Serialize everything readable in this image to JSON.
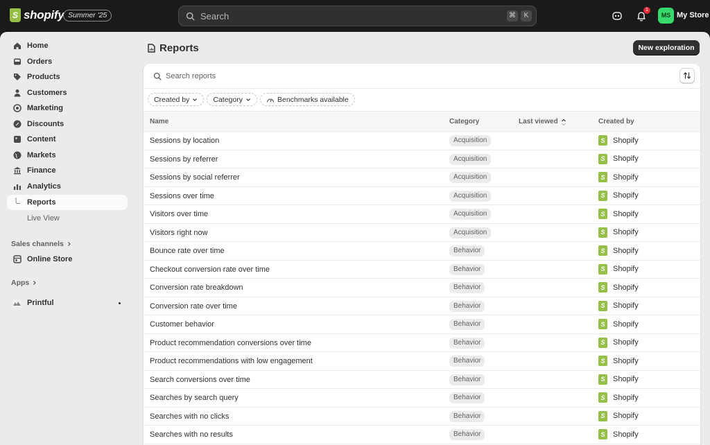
{
  "topbar": {
    "brand": "shopify",
    "edition": "Summer '25",
    "search_placeholder": "Search",
    "shortcut_cmd": "⌘",
    "shortcut_key": "K",
    "notification_count": "1",
    "avatar_initials": "MS",
    "store_name": "My Store"
  },
  "sidebar": {
    "items": [
      {
        "label": "Home",
        "icon": "home-icon"
      },
      {
        "label": "Orders",
        "icon": "inbox-icon"
      },
      {
        "label": "Products",
        "icon": "tag-icon"
      },
      {
        "label": "Customers",
        "icon": "person-icon"
      },
      {
        "label": "Marketing",
        "icon": "target-icon"
      },
      {
        "label": "Discounts",
        "icon": "discount-icon"
      },
      {
        "label": "Content",
        "icon": "content-icon"
      },
      {
        "label": "Markets",
        "icon": "globe-icon"
      },
      {
        "label": "Finance",
        "icon": "bank-icon"
      },
      {
        "label": "Analytics",
        "icon": "chart-icon"
      },
      {
        "label": "Reports",
        "icon": "branch-icon"
      },
      {
        "label": "Live View",
        "icon": ""
      }
    ],
    "sales_channels_label": "Sales channels",
    "online_store_label": "Online Store",
    "apps_label": "Apps",
    "printful_label": "Printful"
  },
  "page": {
    "title": "Reports",
    "new_button": "New exploration",
    "search_placeholder": "Search reports",
    "filters": [
      "Created by",
      "Category",
      "Benchmarks available"
    ],
    "columns": {
      "name": "Name",
      "category": "Category",
      "last_viewed": "Last viewed",
      "created_by": "Created by"
    }
  },
  "reports": [
    {
      "name": "Sessions by location",
      "category": "Acquisition",
      "created_by": "Shopify"
    },
    {
      "name": "Sessions by referrer",
      "category": "Acquisition",
      "created_by": "Shopify"
    },
    {
      "name": "Sessions by social referrer",
      "category": "Acquisition",
      "created_by": "Shopify"
    },
    {
      "name": "Sessions over time",
      "category": "Acquisition",
      "created_by": "Shopify"
    },
    {
      "name": "Visitors over time",
      "category": "Acquisition",
      "created_by": "Shopify"
    },
    {
      "name": "Visitors right now",
      "category": "Acquisition",
      "created_by": "Shopify"
    },
    {
      "name": "Bounce rate over time",
      "category": "Behavior",
      "created_by": "Shopify"
    },
    {
      "name": "Checkout conversion rate over time",
      "category": "Behavior",
      "created_by": "Shopify"
    },
    {
      "name": "Conversion rate breakdown",
      "category": "Behavior",
      "created_by": "Shopify"
    },
    {
      "name": "Conversion rate over time",
      "category": "Behavior",
      "created_by": "Shopify"
    },
    {
      "name": "Customer behavior",
      "category": "Behavior",
      "created_by": "Shopify"
    },
    {
      "name": "Product recommendation conversions over time",
      "category": "Behavior",
      "created_by": "Shopify"
    },
    {
      "name": "Product recommendations with low engagement",
      "category": "Behavior",
      "created_by": "Shopify"
    },
    {
      "name": "Search conversions over time",
      "category": "Behavior",
      "created_by": "Shopify"
    },
    {
      "name": "Searches by search query",
      "category": "Behavior",
      "created_by": "Shopify"
    },
    {
      "name": "Searches with no clicks",
      "category": "Behavior",
      "created_by": "Shopify"
    },
    {
      "name": "Searches with no results",
      "category": "Behavior",
      "created_by": "Shopify"
    }
  ]
}
